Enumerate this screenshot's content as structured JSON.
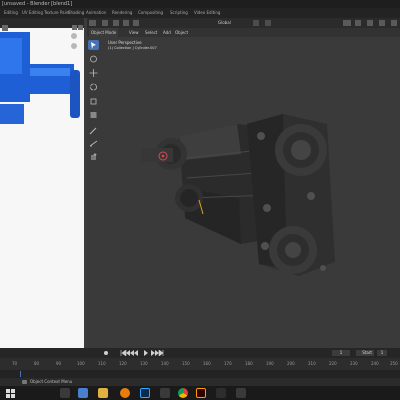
{
  "window": {
    "title": "[unsaved - Blender [blend1]"
  },
  "workspace_tabs": [
    "Editing",
    "UV Editing",
    "Texture Paint",
    "Shading",
    "Animation",
    "Rendering",
    "Compositing",
    "Scripting",
    "Video Editing"
  ],
  "viewport": {
    "transform_orientation": "Global",
    "mode": "Object Mode",
    "menus": [
      "View",
      "Select",
      "Add",
      "Object"
    ],
    "perspective_label": "User Perspective",
    "collection_label": "(1) Collection | Cylinder.007"
  },
  "timeline": {
    "ruler_ticks": [
      "70",
      "80",
      "90",
      "100",
      "110",
      "120",
      "130",
      "140",
      "150",
      "160",
      "170",
      "180",
      "190",
      "200",
      "210",
      "220",
      "230",
      "240",
      "250"
    ],
    "current_frame": "1",
    "start_label": "Start",
    "start_value": "1"
  },
  "status": {
    "context_menu": "Object Context Menu"
  },
  "colors": {
    "accent": "#4772b3",
    "model_blue": "#1f5fd6",
    "taskbar": "#1a1a1a"
  },
  "icons": [
    "play-icon",
    "jump-start-icon",
    "jump-end-icon",
    "windows-start-icon",
    "folder-icon",
    "blender-icon",
    "photoshop-icon",
    "chrome-icon",
    "illustrator-icon"
  ]
}
